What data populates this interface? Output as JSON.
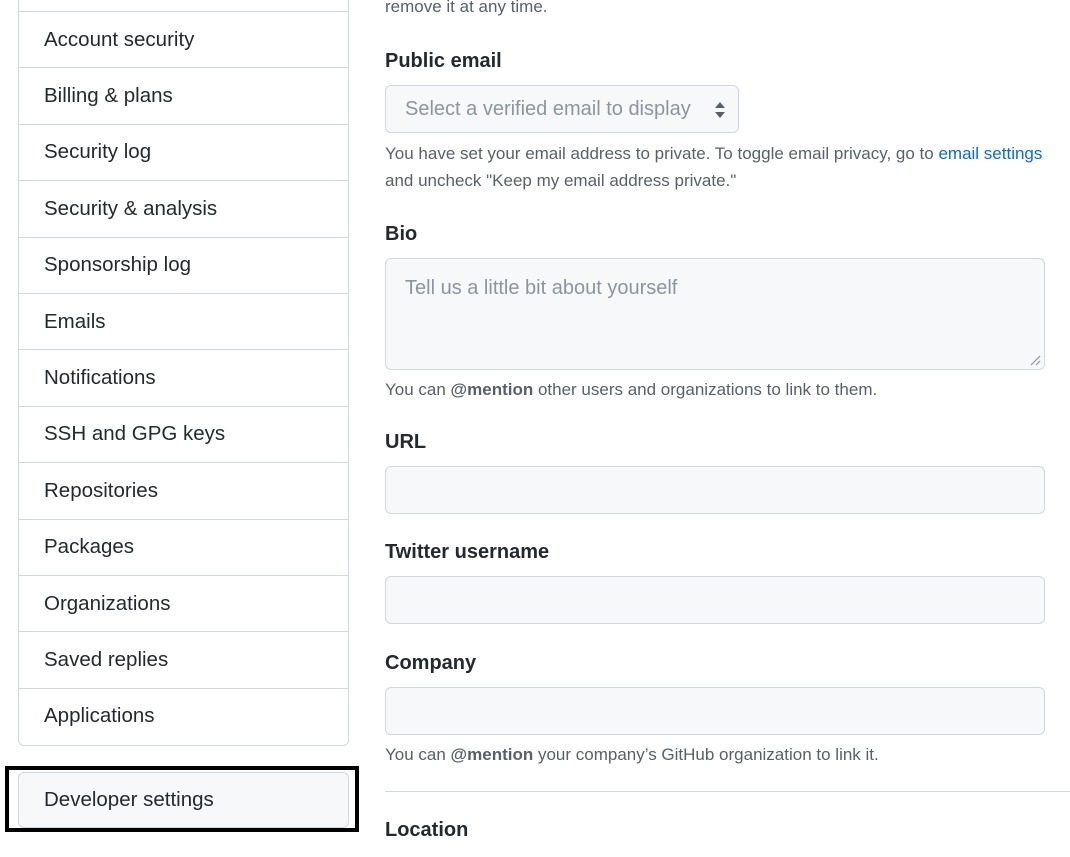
{
  "sidebar": {
    "items": [
      {
        "label": "Account security"
      },
      {
        "label": "Billing & plans"
      },
      {
        "label": "Security log"
      },
      {
        "label": "Security & analysis"
      },
      {
        "label": "Sponsorship log"
      },
      {
        "label": "Emails"
      },
      {
        "label": "Notifications"
      },
      {
        "label": "SSH and GPG keys"
      },
      {
        "label": "Repositories"
      },
      {
        "label": "Packages"
      },
      {
        "label": "Organizations"
      },
      {
        "label": "Saved replies"
      },
      {
        "label": "Applications"
      }
    ],
    "developer_settings": "Developer settings"
  },
  "form": {
    "top_note": "remove it at any time.",
    "public_email": {
      "label": "Public email",
      "select_value": "Select a verified email to display",
      "help_part1": "You have set your email address to private. To toggle email privacy, go to ",
      "help_link": "email settings",
      "help_line2": "and uncheck \"Keep my email address private.\""
    },
    "bio": {
      "label": "Bio",
      "placeholder": "Tell us a little bit about yourself",
      "help_pre": "You can ",
      "help_mention": "@mention",
      "help_post": " other users and organizations to link to them."
    },
    "url": {
      "label": "URL",
      "value": ""
    },
    "twitter": {
      "label": "Twitter username",
      "value": ""
    },
    "company": {
      "label": "Company",
      "value": "",
      "help_pre": "You can ",
      "help_mention": "@mention",
      "help_post": " your company’s GitHub organization to link it."
    },
    "location": {
      "label": "Location"
    }
  },
  "colors": {
    "link": "#0969da",
    "border": "#d0d7de",
    "input_bg": "#f6f8fa",
    "highlight_box": "#000000"
  }
}
